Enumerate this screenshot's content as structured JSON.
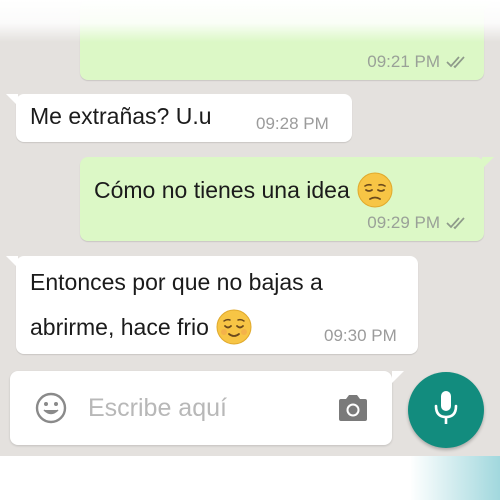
{
  "chat": {
    "messages": [
      {
        "direction": "out",
        "text": "",
        "time": "09:21 PM",
        "status": "read-double-check"
      },
      {
        "direction": "in",
        "text": "Me extrañas? U.u",
        "time": "09:28 PM"
      },
      {
        "direction": "out",
        "text": "Cómo no tienes una idea",
        "emoji": "pensive-face",
        "time": "09:29 PM",
        "status": "read-double-check"
      },
      {
        "direction": "in",
        "line1": "Entonces por que no bajas a",
        "line2": "abrirme, hace frio",
        "emoji": "relieved-face",
        "time": "09:30 PM"
      }
    ]
  },
  "composer": {
    "placeholder": "Escribe aquí",
    "value": "",
    "icons": {
      "emoji_button": "smiley-icon",
      "attach_camera": "camera-icon",
      "send_voice": "microphone-icon"
    }
  },
  "colors": {
    "chat_background": "#e4e1de",
    "outgoing_bubble": "#dcf8c6",
    "incoming_bubble": "#ffffff",
    "mic_button": "#128c7e",
    "timestamp": "#9aa198",
    "emoji_yellow": "#f7c545"
  }
}
